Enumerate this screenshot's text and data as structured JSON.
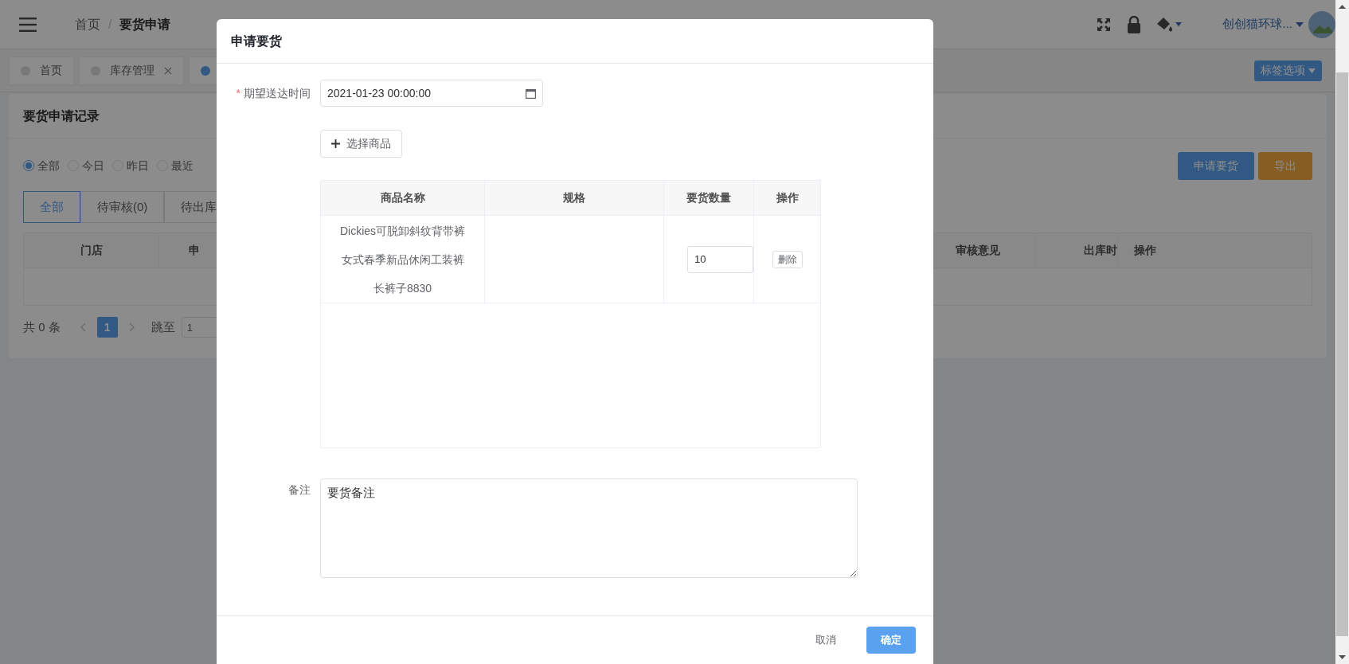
{
  "header": {
    "breadcrumb_separator": "/",
    "breadcrumb": [
      {
        "label": "首页",
        "current": false
      },
      {
        "label": "要货申请",
        "current": true
      }
    ],
    "user_name": "创创猫环球..."
  },
  "tag_bar": {
    "tags": [
      {
        "label": "首页",
        "selected": false,
        "closable": false
      },
      {
        "label": "库存管理",
        "selected": false,
        "closable": true
      },
      {
        "selected": true,
        "closable": false
      }
    ],
    "options_button": "标签选项"
  },
  "records_card": {
    "title": "要货申请记录",
    "date_filters": [
      {
        "label": "全部",
        "selected": true
      },
      {
        "label": "今日",
        "selected": false
      },
      {
        "label": "昨日",
        "selected": false
      },
      {
        "label": "最近",
        "selected": false
      }
    ],
    "status_tabs": [
      {
        "label": "全部",
        "selected": true
      },
      {
        "label": "待审核(0)",
        "selected": false
      },
      {
        "label": "待出库",
        "selected": false
      }
    ],
    "actions": [
      {
        "label": "申请要货",
        "kind": "primary"
      },
      {
        "label": "导出",
        "kind": "warning"
      }
    ],
    "table": {
      "columns_left": [
        "门店",
        "申"
      ],
      "columns_right": [
        "审核意见",
        "出库时",
        "操作"
      ]
    },
    "pagination": {
      "total": "共 0 条",
      "pages": [
        {
          "label": "1",
          "selected": true
        }
      ],
      "jump_label": "跳至",
      "jump_value": "1"
    }
  },
  "dialog": {
    "title": "申请要货",
    "date_field": {
      "label": "期望送达时间",
      "required_mark": "*",
      "value": "2021-01-23 00:00:00"
    },
    "select_button": "选择商品",
    "table": {
      "columns": [
        "商品名称",
        "规格",
        "要货数量",
        "操作"
      ],
      "rows": [
        {
          "name_lines": [
            "Dickies可脱卸斜纹背带裤",
            "女式春季新品休闲工装裤",
            "长裤子8830"
          ],
          "quantity": "10",
          "action": "删除"
        }
      ]
    },
    "remark": {
      "label": "备注",
      "value": "要货备注"
    },
    "buttons": [
      {
        "label": "取消",
        "kind": "text"
      },
      {
        "label": "确定",
        "kind": "primary"
      }
    ]
  }
}
